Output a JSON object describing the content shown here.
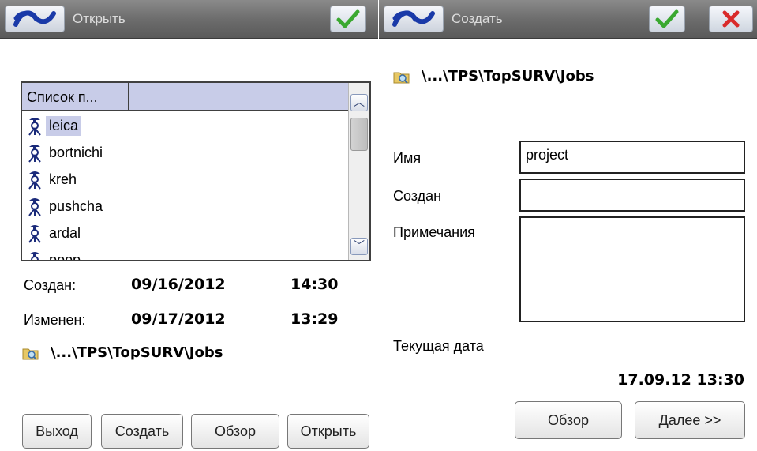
{
  "open_panel": {
    "title": "Открыть",
    "list": {
      "column_header": "Список п...",
      "items": [
        "leica",
        "bortnichi",
        "kreh",
        "pushcha",
        "ardal",
        "pppp"
      ],
      "selected_index": 0
    },
    "created_label": "Создан:",
    "created_date": "09/16/2012",
    "created_time": "14:30",
    "modified_label": "Изменен:",
    "modified_date": "09/17/2012",
    "modified_time": "13:29",
    "path": "\\...\\TPS\\TopSURV\\Jobs",
    "buttons": {
      "exit": "Выход",
      "create": "Создать",
      "browse": "Обзор",
      "open": "Открыть"
    }
  },
  "create_panel": {
    "title": "Создать",
    "path": "\\...\\TPS\\TopSURV\\Jobs",
    "name_label": "Имя",
    "name_value": "project",
    "created_label": "Создан",
    "created_value": "",
    "notes_label": "Примечания",
    "notes_value": "",
    "current_date_label": "Текущая дата",
    "current_date_value": "17.09.12 13:30",
    "buttons": {
      "browse": "Обзор",
      "next": "Далее >>"
    }
  },
  "icons": {
    "logo": "topcon-logo-icon",
    "ok": "checkmark-icon",
    "cancel": "close-icon",
    "folder": "folder-search-icon",
    "job": "surveyor-tripod-icon"
  },
  "colors": {
    "titlebar": "#6d6d6d",
    "selection": "#c8cce8",
    "ok_green": "#3aa830",
    "cancel_red": "#d92a2a",
    "logo_blue": "#1a3aa8"
  }
}
